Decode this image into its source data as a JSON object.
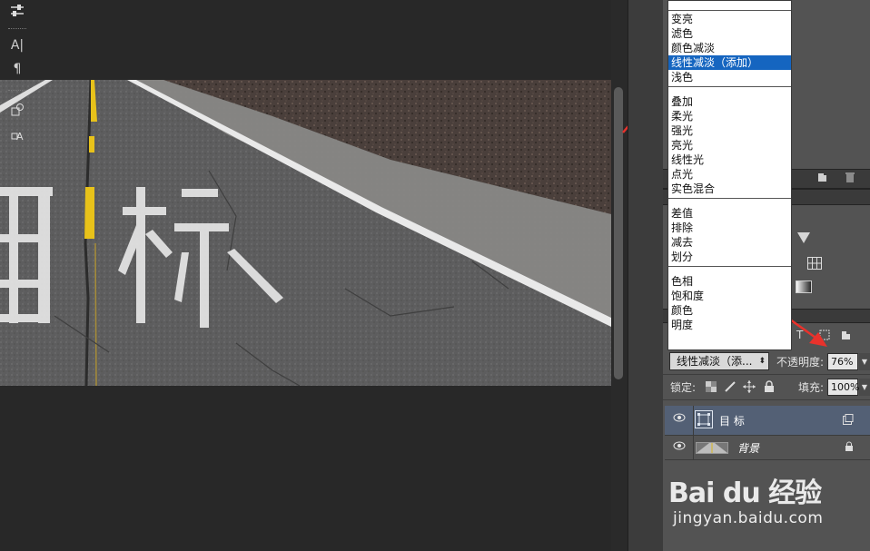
{
  "canvas": {
    "image_text": "目标"
  },
  "blend_menu": {
    "groups": [
      [
        "变亮",
        "滤色",
        "颜色减淡",
        "线性减淡（添加）",
        "浅色"
      ],
      [
        "叠加",
        "柔光",
        "强光",
        "亮光",
        "线性光",
        "点光",
        "实色混合"
      ],
      [
        "差值",
        "排除",
        "减去",
        "划分"
      ],
      [
        "色相",
        "饱和度",
        "颜色",
        "明度"
      ]
    ],
    "selected": "线性减淡（添加）"
  },
  "layers_panel": {
    "blend_mode_value": "线性减淡（添...",
    "opacity_label": "不透明度:",
    "opacity_value": "76%",
    "lock_label": "锁定:",
    "fill_label": "填充:",
    "fill_value": "100%",
    "layers": [
      {
        "name": "目 标",
        "type": "text",
        "selected": true
      },
      {
        "name": "背景",
        "type": "background",
        "selected": false
      }
    ]
  },
  "watermark": {
    "logo": "Bai du 经验",
    "url": "jingyan.baidu.com"
  },
  "icons": [
    "sliders-icon",
    "character-icon",
    "paragraph-icon",
    "shapes-icon",
    "text-style-icon",
    "eye-icon",
    "new-layer-icon",
    "trash-icon",
    "lock-icon",
    "move-icon",
    "brush-icon",
    "checker-icon"
  ],
  "colors": {
    "menu_selected": "#1565c0",
    "layer_selected": "#536075",
    "annotation_arrow": "#e8322c",
    "lane_yellow": "#e8c21a"
  }
}
